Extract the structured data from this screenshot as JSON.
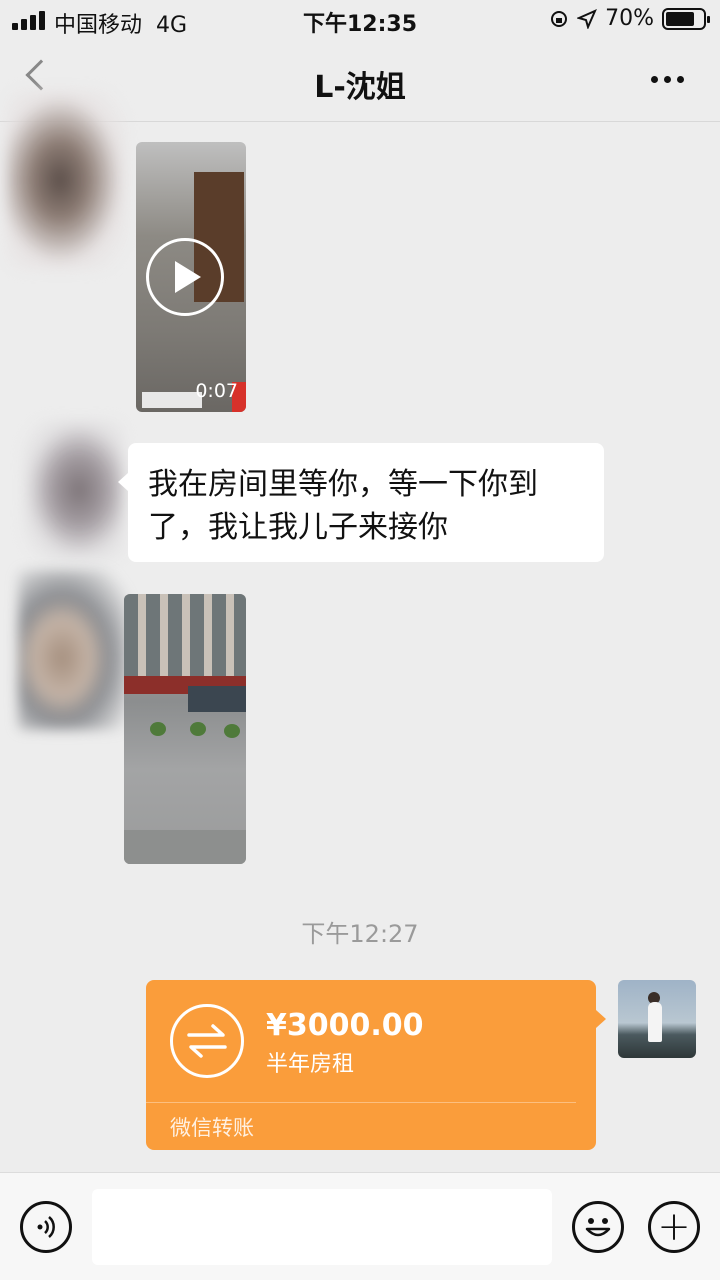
{
  "status_bar": {
    "carrier": "中国移动",
    "network": "4G",
    "time": "下午12:35",
    "battery": "70%",
    "battery_level": 0.7
  },
  "nav": {
    "title": "L-沈姐",
    "back_icon": "chevron-left-icon",
    "more_icon": "more-dots-icon"
  },
  "messages": {
    "video": {
      "duration": "0:07",
      "icon": "play-icon"
    },
    "text": {
      "line1": "我在房间里等你，等一下你到",
      "line2": "了，我让我儿子来接你"
    },
    "timestamp": "下午12:27",
    "transfer": {
      "amount": "¥3000.00",
      "memo": "半年房租",
      "label": "微信转账",
      "color": "#fa9d3b",
      "icon": "transfer-arrows-icon"
    }
  },
  "input_bar": {
    "placeholder": "",
    "voice_icon": "voice-icon",
    "emoji_icon": "emoji-icon",
    "plus_icon": "plus-icon",
    "plus_glyph": "+"
  }
}
